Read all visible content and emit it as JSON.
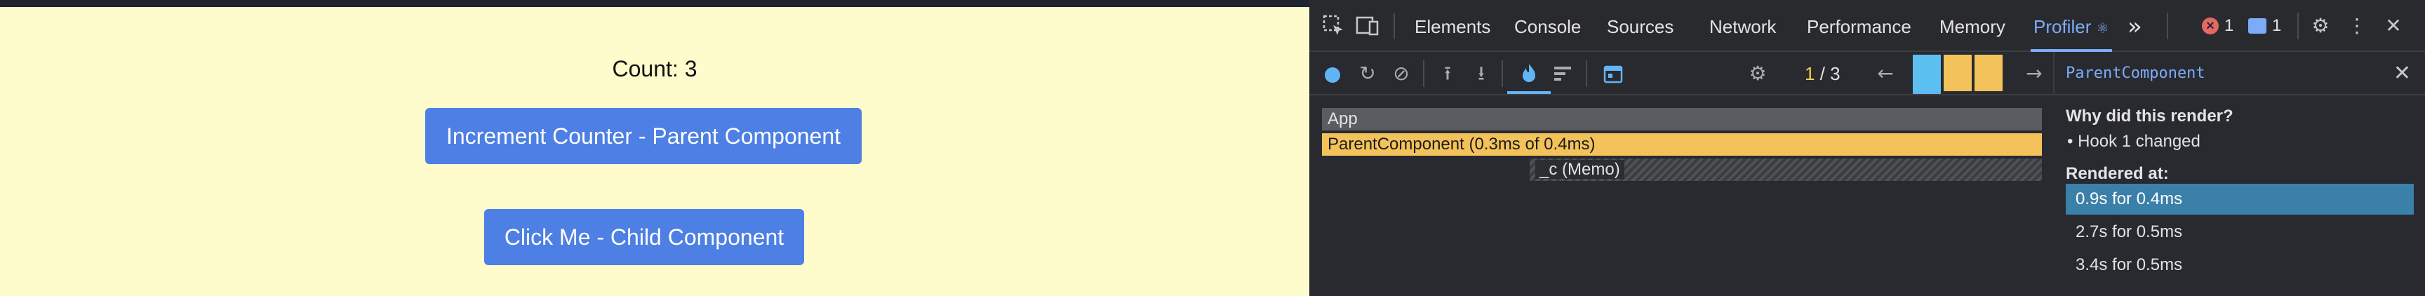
{
  "app": {
    "count_text": "Count: 3",
    "parent_button": "Increment Counter - Parent Component",
    "child_button": "Click Me - Child Component"
  },
  "devtools": {
    "tabs": [
      "Elements",
      "Console",
      "Sources",
      "Network",
      "Performance",
      "Memory",
      "Profiler"
    ],
    "active_tab": "Profiler",
    "active_tab_suffix": "⚛",
    "more_tabs": "»",
    "error_count": "1",
    "message_count": "1",
    "icons": {
      "inspect": "select-element-icon",
      "device": "device-toolbar-icon",
      "settings": "gear-icon",
      "menu": "kebab-menu-icon",
      "close": "close-icon"
    }
  },
  "profiler": {
    "commit_current": "1",
    "commit_separator": "/",
    "commit_total": "3",
    "commit_colors": [
      "#5bc0ef",
      "#f3c25a",
      "#f3c25a"
    ],
    "flame": {
      "root": "App",
      "parent": "ParentComponent (0.3ms of 0.4ms)",
      "child": "_c (Memo)"
    }
  },
  "side_panel": {
    "title": "ParentComponent",
    "why_heading": "Why did this render?",
    "why_items": [
      "• Hook 1 changed"
    ],
    "rendered_heading": "Rendered at:",
    "renders": [
      "0.9s for 0.4ms",
      "2.7s for 0.5ms",
      "3.4s for 0.5ms"
    ],
    "selected_render": 0
  },
  "colors": {
    "page_bg": "#fefbcc",
    "button": "#4d7fe4",
    "devtools_bg": "#282a2f",
    "accent": "#7cacf8",
    "flame_parent": "#f3c25a",
    "selection": "#3b80a9"
  }
}
